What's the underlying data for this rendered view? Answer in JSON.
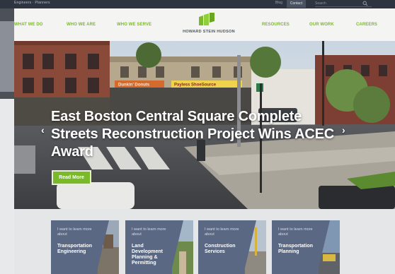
{
  "utility_bar": {
    "breadcrumb": "Engineers · Planners",
    "blog_label": "Blog",
    "contact_label": "Contact",
    "search_placeholder": "Search"
  },
  "nav": {
    "links": [
      {
        "label": "WHAT WE DO"
      },
      {
        "label": "WHO WE ARE"
      },
      {
        "label": "WHO WE SERVE"
      },
      {
        "label": "RESOURCES"
      },
      {
        "label": "OUR WORK"
      },
      {
        "label": "CAREERS"
      }
    ],
    "logo_text": "HOWARD STEIN HUDSON"
  },
  "hero": {
    "headline": "East Boston Central Square Complete Streets Reconstruction Project Wins ACEC Award",
    "read_more_label": "Read More",
    "prev_arrow": "‹",
    "next_arrow": "›",
    "storefront_signs": [
      "Dunkin' Donuts",
      "Payless ShoeSource",
      "Payless"
    ]
  },
  "services": {
    "cards": [
      {
        "pre": "I want to learn more about",
        "title": "Transportation Engineering"
      },
      {
        "pre": "I want to learn more about",
        "title": "Land Development Planning & Permitting"
      },
      {
        "pre": "I want to learn more about",
        "title": "Construction Services"
      },
      {
        "pre": "I want to learn more about",
        "title": "Transportation Planning"
      }
    ]
  },
  "colors": {
    "brand_green": "#7ab929",
    "utility_bar": "#2f3540",
    "card_blue": "#5b6883"
  }
}
